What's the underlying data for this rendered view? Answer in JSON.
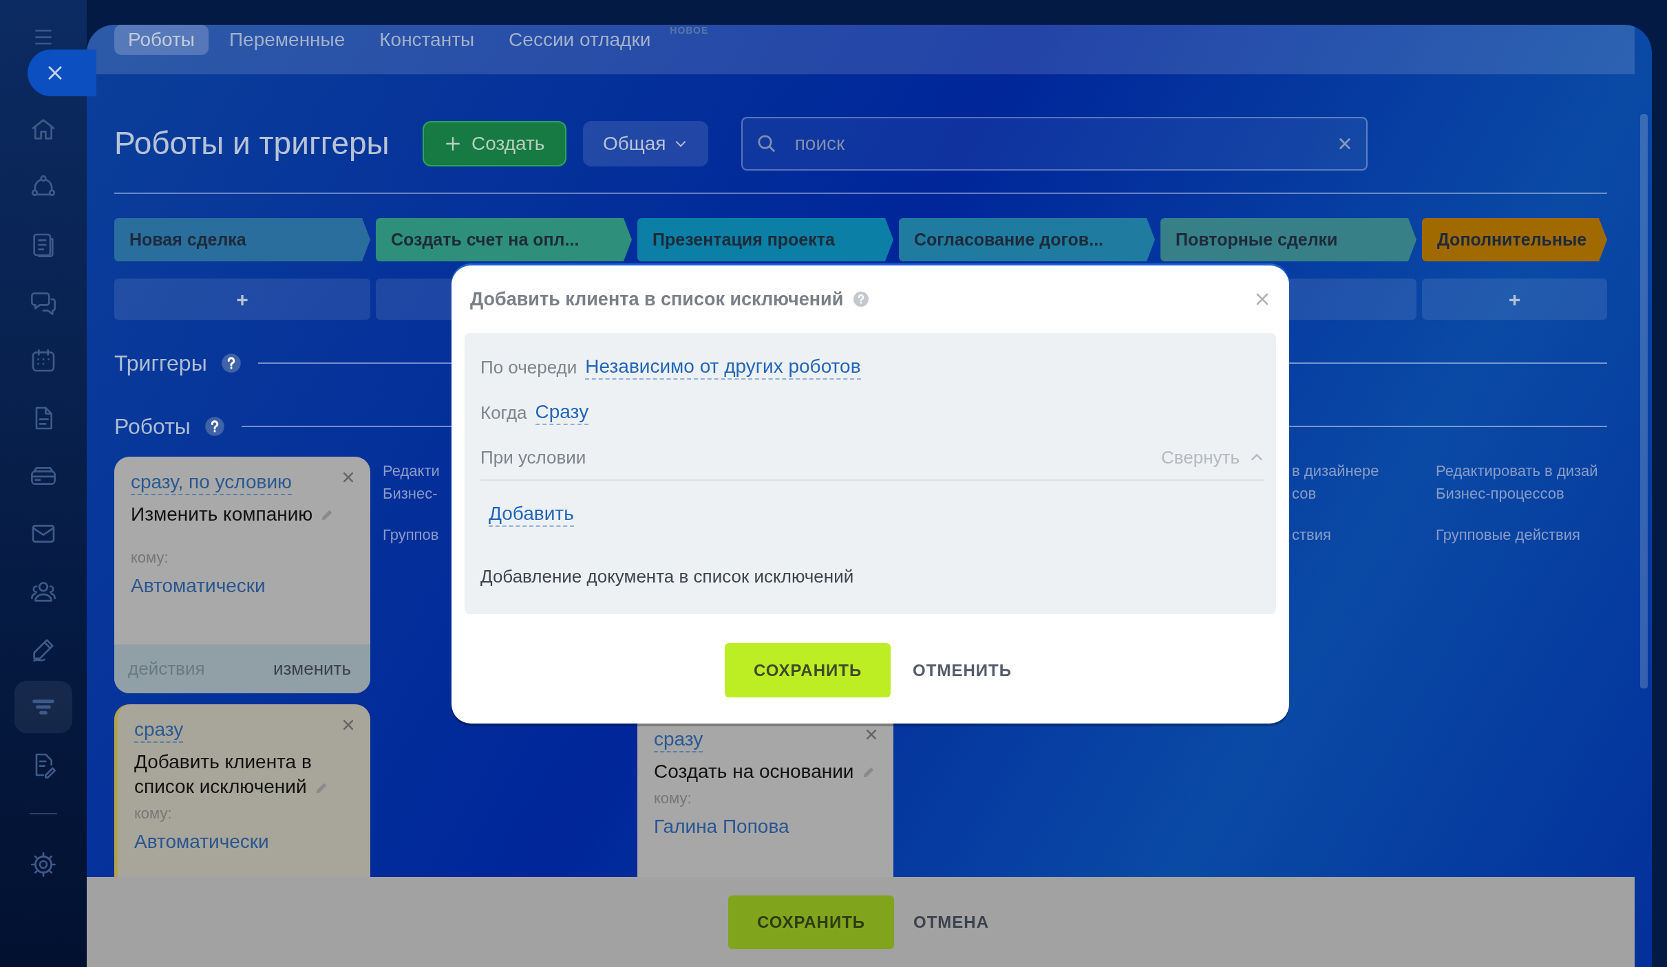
{
  "sidebar": {
    "items": [
      {
        "selected": false
      },
      {
        "selected": false
      },
      {
        "selected": false
      },
      {
        "selected": false
      },
      {
        "selected": false
      },
      {
        "selected": false
      },
      {
        "selected": false
      },
      {
        "selected": false
      },
      {
        "selected": false
      },
      {
        "selected": false
      },
      {
        "selected": true
      },
      {
        "selected": false
      },
      {
        "selected": false
      }
    ]
  },
  "tabs": [
    {
      "label": "Роботы",
      "selected": true
    },
    {
      "label": "Переменные",
      "selected": false
    },
    {
      "label": "Константы",
      "selected": false
    },
    {
      "label": "Сессии отладки",
      "selected": false,
      "badge": "НОВОЕ"
    }
  ],
  "header": {
    "title": "Роботы и триггеры",
    "create_button": "Создать",
    "filter_button": "Общая",
    "search": {
      "placeholder": "поиск"
    }
  },
  "stages": [
    {
      "label": "Новая сделка",
      "color": "#2a6e9e"
    },
    {
      "label": "Создать счет на опл...",
      "color": "#2e8f7a"
    },
    {
      "label": "Презентация проекта",
      "color": "#0b7fa6"
    },
    {
      "label": "Согласование догов...",
      "color": "#1f7ca0"
    },
    {
      "label": "Повторные сделки",
      "color": "#378088"
    },
    {
      "label": "Дополнительные",
      "color": "#a06a00"
    }
  ],
  "add_buttons": [
    "+",
    "+"
  ],
  "sections": [
    {
      "title": "Триггеры"
    },
    {
      "title": "Роботы"
    }
  ],
  "robot_cards": [
    {
      "kind": "default",
      "condition": "сразу, по условию",
      "title": "Изменить компанию",
      "to_label": "кому:",
      "assignee": "Автоматически",
      "footer": {
        "actions": "действия",
        "actions_disabled": true,
        "edit": "изменить"
      }
    },
    {
      "kind": "highlighted",
      "condition": "сразу",
      "title": "Добавить клиента в список исключений",
      "to_label": "кому:",
      "assignee": "Автоматически"
    }
  ],
  "column_2_links": {
    "edit": [
      "Редакти",
      "Бизнес-"
    ],
    "group": "Группов"
  },
  "column_3_card": {
    "condition": "сразу",
    "title": "Создать на основании",
    "to_label": "кому:",
    "assignee": "Галина Попова"
  },
  "column_5_links": {
    "edit": [
      "в дизайнере",
      "сов"
    ],
    "group": "ствия"
  },
  "column_6_links": {
    "edit": [
      "Редактировать в дизай",
      "Бизнес-процессов"
    ],
    "group": "Групповые действия"
  },
  "modal": {
    "title": "Добавить клиента в список исключений",
    "fields": [
      {
        "label": "По очереди",
        "value": "Независимо от других роботов"
      },
      {
        "label": "Когда",
        "value": "Сразу"
      }
    ],
    "condition": {
      "label": "При условии",
      "toggle": "Свернуть",
      "expanded": true,
      "add_link": "Добавить"
    },
    "description": "Добавление документа в список исключений",
    "save": "СОХРАНИТЬ",
    "cancel": "ОТМЕНИТЬ"
  },
  "footer": {
    "save": "СОХРАНИТЬ",
    "cancel": "ОТМЕНА"
  }
}
